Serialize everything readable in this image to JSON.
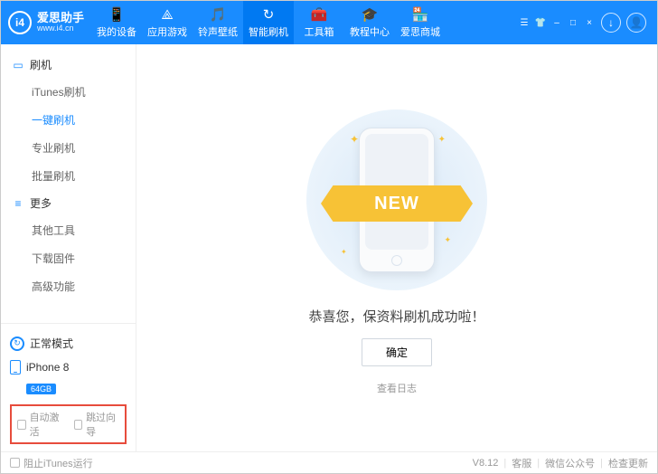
{
  "brand": {
    "logo_text": "i4",
    "title": "爱思助手",
    "url": "www.i4.cn"
  },
  "tabs": [
    {
      "id": "devices",
      "label": "我的设备",
      "icon": "📱"
    },
    {
      "id": "apps",
      "label": "应用游戏",
      "icon": "⟁"
    },
    {
      "id": "ringtone",
      "label": "铃声壁纸",
      "icon": "🎵"
    },
    {
      "id": "flash",
      "label": "智能刷机",
      "icon": "↻",
      "active": true
    },
    {
      "id": "toolbox",
      "label": "工具箱",
      "icon": "🧰"
    },
    {
      "id": "tutorial",
      "label": "教程中心",
      "icon": "🎓"
    },
    {
      "id": "mall",
      "label": "爱思商城",
      "icon": "🏪"
    }
  ],
  "sidebar": {
    "sections": [
      {
        "title": "刷机",
        "icon": "▭",
        "items": [
          {
            "label": "iTunes刷机"
          },
          {
            "label": "一键刷机",
            "active": true
          },
          {
            "label": "专业刷机"
          },
          {
            "label": "批量刷机"
          }
        ]
      },
      {
        "title": "更多",
        "icon": "≡",
        "items": [
          {
            "label": "其他工具"
          },
          {
            "label": "下载固件"
          },
          {
            "label": "高级功能"
          }
        ]
      }
    ],
    "mode_label": "正常模式",
    "device_name": "iPhone 8",
    "device_storage": "64GB",
    "check_auto_activate": "自动激活",
    "check_skip_wizard": "跳过向导"
  },
  "main": {
    "ribbon_text": "NEW",
    "success_msg": "恭喜您，保资料刷机成功啦！",
    "ok_label": "确定",
    "log_label": "查看日志"
  },
  "footer": {
    "block_itunes": "阻止iTunes运行",
    "version": "V8.12",
    "support": "客服",
    "wechat": "微信公众号",
    "update": "检查更新"
  }
}
